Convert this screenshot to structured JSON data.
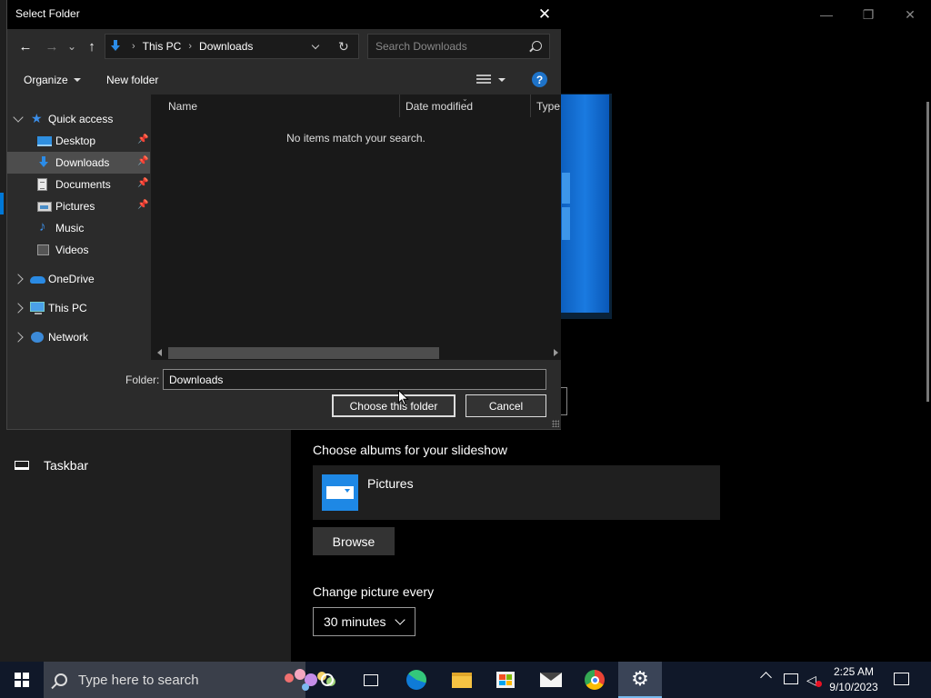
{
  "dialog": {
    "title": "Select Folder",
    "close_glyph": "✕",
    "nav": {
      "back": "←",
      "forward": "→",
      "recent": "⌄",
      "up": "↑"
    },
    "breadcrumb": [
      "This PC",
      "Downloads"
    ],
    "breadcrumb_sep": "›",
    "refresh_glyph": "↻",
    "search_placeholder": "Search Downloads",
    "organize_label": "Organize",
    "new_folder_label": "New folder",
    "help_glyph": "?",
    "nav_tree": [
      {
        "label": "Quick access",
        "icon": "star-icon"
      },
      {
        "label": "Desktop",
        "icon": "desktop-icon"
      },
      {
        "label": "Downloads",
        "icon": "download-icon"
      },
      {
        "label": "Documents",
        "icon": "documents-icon"
      },
      {
        "label": "Pictures",
        "icon": "pictures-icon"
      },
      {
        "label": "Music",
        "icon": "music-icon"
      },
      {
        "label": "Videos",
        "icon": "videos-icon"
      },
      {
        "label": "OneDrive",
        "icon": "cloud-icon"
      },
      {
        "label": "This PC",
        "icon": "computer-icon"
      },
      {
        "label": "Network",
        "icon": "network-icon"
      }
    ],
    "columns": [
      "Name",
      "Date modified",
      "Type"
    ],
    "empty_message": "No items match your search.",
    "folder_label": "Folder:",
    "folder_value": "Downloads",
    "choose_label": "Choose this folder",
    "cancel_label": "Cancel"
  },
  "settings": {
    "window_controls": {
      "minimize": "—",
      "maximize": "❐",
      "close": "✕"
    },
    "sidebar_item": "Taskbar",
    "albums_label": "Choose albums for your slideshow",
    "album_name": "Pictures",
    "browse_label": "Browse",
    "change_label": "Change picture every",
    "interval_value": "30 minutes"
  },
  "taskbar": {
    "search_placeholder": "Type here to search",
    "settings_glyph": "⚙",
    "clock_time": "2:25 AM",
    "clock_date": "9/10/2023",
    "apps": [
      "cortana-icon",
      "task-view-icon",
      "edge-icon",
      "file-explorer-icon",
      "store-icon",
      "mail-icon",
      "chrome-icon",
      "settings-icon"
    ]
  },
  "colors": {
    "accent": "#0078d7",
    "dialog_bg": "#2b2b2b",
    "file_pane_bg": "#191919",
    "taskbar_bg": "#101829"
  }
}
